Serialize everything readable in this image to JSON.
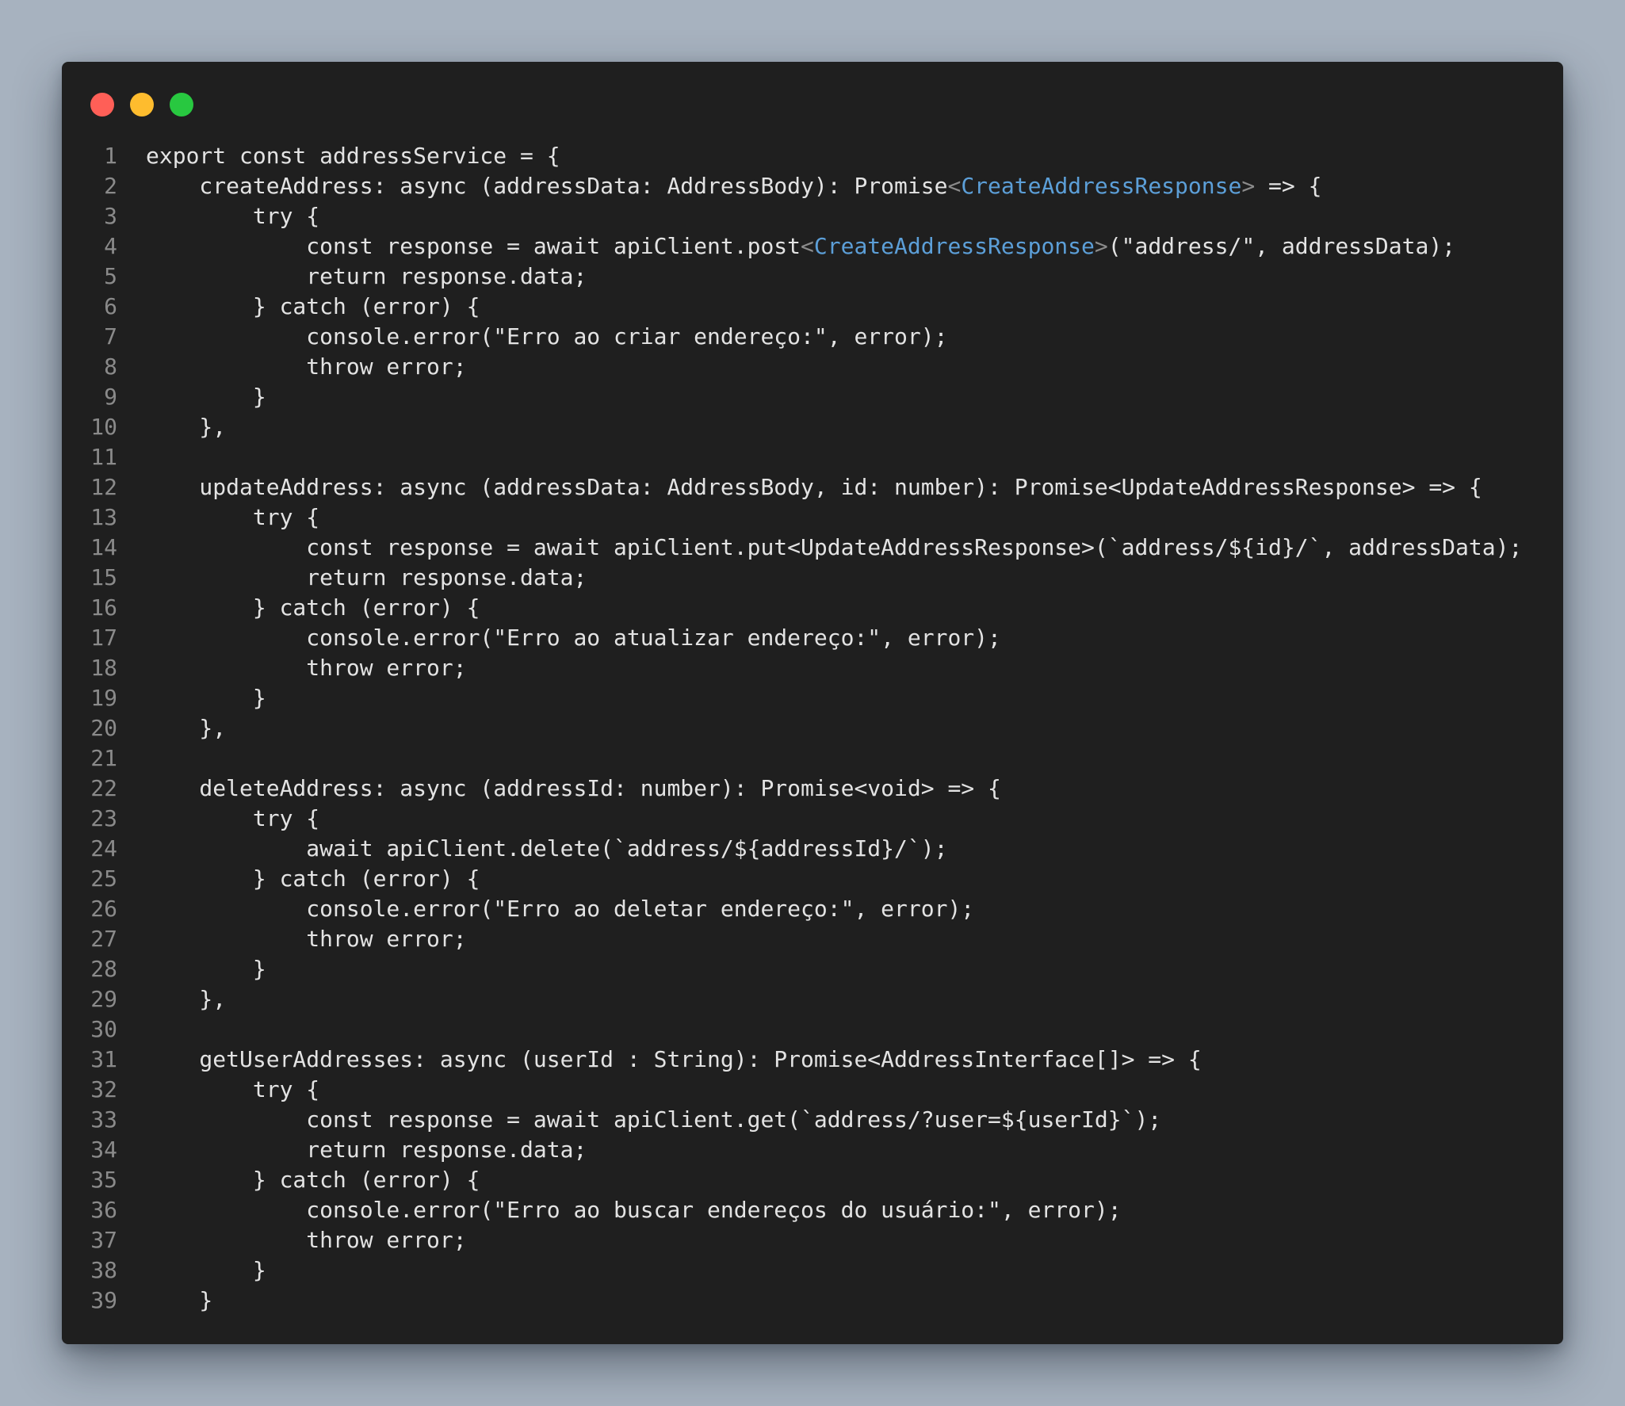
{
  "window": {
    "controls": [
      {
        "name": "close-button",
        "color": "#ff5f57"
      },
      {
        "name": "minimize-button",
        "color": "#febc2e"
      },
      {
        "name": "maximize-button",
        "color": "#28c840"
      }
    ]
  },
  "code": {
    "language": "typescript",
    "lines": [
      {
        "n": "1",
        "segs": [
          {
            "t": "export const addressService = {"
          }
        ]
      },
      {
        "n": "2",
        "segs": [
          {
            "t": "    createAddress: async (addressData: AddressBody): Promise"
          },
          {
            "t": "<",
            "c": "g"
          },
          {
            "t": "CreateAddressResponse",
            "c": "t"
          },
          {
            "t": ">",
            "c": "g"
          },
          {
            "t": " => {"
          }
        ]
      },
      {
        "n": "3",
        "segs": [
          {
            "t": "        try {"
          }
        ]
      },
      {
        "n": "4",
        "segs": [
          {
            "t": "            const response = await apiClient.post"
          },
          {
            "t": "<",
            "c": "g"
          },
          {
            "t": "CreateAddressResponse",
            "c": "t"
          },
          {
            "t": ">",
            "c": "g"
          },
          {
            "t": "(\"address/\", addressData);"
          }
        ]
      },
      {
        "n": "5",
        "segs": [
          {
            "t": "            return response.data;"
          }
        ]
      },
      {
        "n": "6",
        "segs": [
          {
            "t": "        } catch (error) {"
          }
        ]
      },
      {
        "n": "7",
        "segs": [
          {
            "t": "            console.error(\"Erro ao criar endereço:\", error);"
          }
        ]
      },
      {
        "n": "8",
        "segs": [
          {
            "t": "            throw error;"
          }
        ]
      },
      {
        "n": "9",
        "segs": [
          {
            "t": "        }"
          }
        ]
      },
      {
        "n": "10",
        "segs": [
          {
            "t": "    },"
          }
        ]
      },
      {
        "n": "11",
        "segs": [
          {
            "t": ""
          }
        ]
      },
      {
        "n": "12",
        "segs": [
          {
            "t": "    updateAddress: async (addressData: AddressBody, id: number): Promise<UpdateAddressResponse> => {"
          }
        ]
      },
      {
        "n": "13",
        "segs": [
          {
            "t": "        try {"
          }
        ]
      },
      {
        "n": "14",
        "segs": [
          {
            "t": "            const response = await apiClient.put<UpdateAddressResponse>(`address/${id}/`, addressData);"
          }
        ]
      },
      {
        "n": "15",
        "segs": [
          {
            "t": "            return response.data;"
          }
        ]
      },
      {
        "n": "16",
        "segs": [
          {
            "t": "        } catch (error) {"
          }
        ]
      },
      {
        "n": "17",
        "segs": [
          {
            "t": "            console.error(\"Erro ao atualizar endereço:\", error);"
          }
        ]
      },
      {
        "n": "18",
        "segs": [
          {
            "t": "            throw error;"
          }
        ]
      },
      {
        "n": "19",
        "segs": [
          {
            "t": "        }"
          }
        ]
      },
      {
        "n": "20",
        "segs": [
          {
            "t": "    },"
          }
        ]
      },
      {
        "n": "21",
        "segs": [
          {
            "t": ""
          }
        ]
      },
      {
        "n": "22",
        "segs": [
          {
            "t": "    deleteAddress: async (addressId: number): Promise<void> => {"
          }
        ]
      },
      {
        "n": "23",
        "segs": [
          {
            "t": "        try {"
          }
        ]
      },
      {
        "n": "24",
        "segs": [
          {
            "t": "            await apiClient.delete(`address/${addressId}/`);"
          }
        ]
      },
      {
        "n": "25",
        "segs": [
          {
            "t": "        } catch (error) {"
          }
        ]
      },
      {
        "n": "26",
        "segs": [
          {
            "t": "            console.error(\"Erro ao deletar endereço:\", error);"
          }
        ]
      },
      {
        "n": "27",
        "segs": [
          {
            "t": "            throw error;"
          }
        ]
      },
      {
        "n": "28",
        "segs": [
          {
            "t": "        }"
          }
        ]
      },
      {
        "n": "29",
        "segs": [
          {
            "t": "    },"
          }
        ]
      },
      {
        "n": "30",
        "segs": [
          {
            "t": ""
          }
        ]
      },
      {
        "n": "31",
        "segs": [
          {
            "t": "    getUserAddresses: async (userId : String): Promise<AddressInterface[]> => {"
          }
        ]
      },
      {
        "n": "32",
        "segs": [
          {
            "t": "        try {"
          }
        ]
      },
      {
        "n": "33",
        "segs": [
          {
            "t": "            const response = await apiClient.get(`address/?user=${userId}`);"
          }
        ]
      },
      {
        "n": "34",
        "segs": [
          {
            "t": "            return response.data;"
          }
        ]
      },
      {
        "n": "35",
        "segs": [
          {
            "t": "        } catch (error) {"
          }
        ]
      },
      {
        "n": "36",
        "segs": [
          {
            "t": "            console.error(\"Erro ao buscar endereços do usuário:\", error);"
          }
        ]
      },
      {
        "n": "37",
        "segs": [
          {
            "t": "            throw error;"
          }
        ]
      },
      {
        "n": "38",
        "segs": [
          {
            "t": "        }"
          }
        ]
      },
      {
        "n": "39",
        "segs": [
          {
            "t": "    }"
          }
        ]
      }
    ]
  }
}
